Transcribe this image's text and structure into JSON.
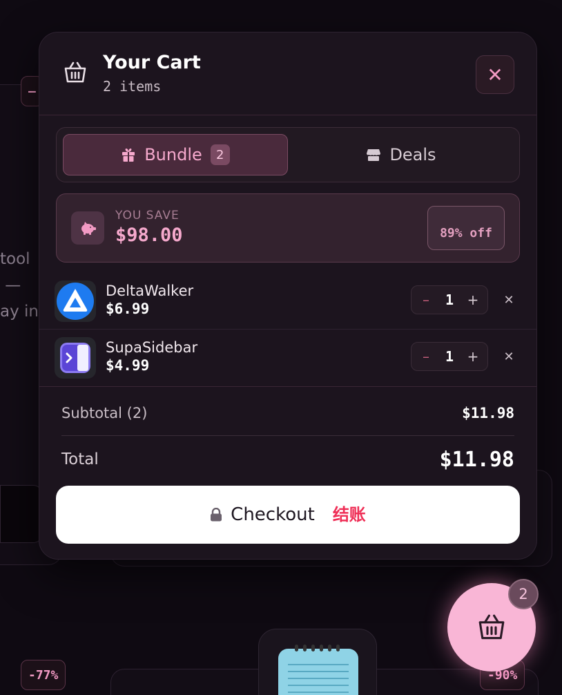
{
  "background": {
    "text_lines": [
      "tool",
      " —",
      "ay in"
    ],
    "badge_left_bottom": "-77%",
    "badge_right_bottom": "-90%",
    "badge_top_partial": "–"
  },
  "cart": {
    "title": "Your Cart",
    "item_count_label": "2 items",
    "close_icon": "✕",
    "tabs": [
      {
        "label": "Bundle",
        "icon": "gift-icon",
        "badge": "2",
        "active": true
      },
      {
        "label": "Deals",
        "icon": "storefront-icon",
        "active": false
      }
    ],
    "savings": {
      "label": "YOU SAVE",
      "amount": "$98.00",
      "percent_off": "89% off"
    },
    "items": [
      {
        "name": "DeltaWalker",
        "price": "$6.99",
        "quantity": "1",
        "icon": "deltawalker-app-icon"
      },
      {
        "name": "SupaSidebar",
        "price": "$4.99",
        "quantity": "1",
        "icon": "supasidebar-app-icon"
      }
    ],
    "stepper": {
      "minus": "–",
      "plus": "+",
      "remove": "✕"
    },
    "subtotal_label": "Subtotal (2)",
    "subtotal_value": "$11.98",
    "total_label": "Total",
    "total_value": "$11.98",
    "checkout_label": "Checkout",
    "checkout_cn": "结账",
    "colors": {
      "accent": "#f6a9cd",
      "panel": "#1c141e",
      "checkout_cn": "#ef2e56"
    }
  },
  "fab": {
    "badge": "2"
  }
}
